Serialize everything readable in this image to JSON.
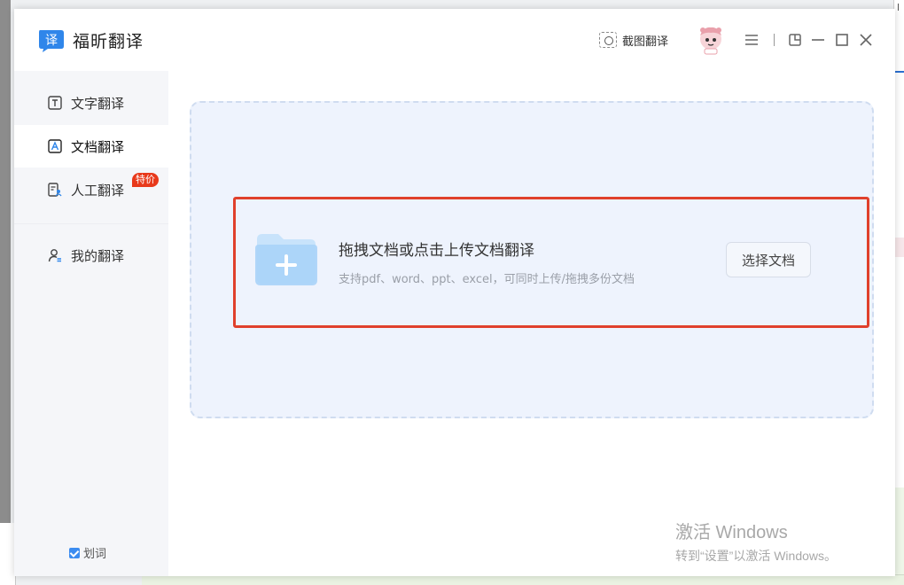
{
  "app": {
    "title": "福昕翻译",
    "logo_char": "译"
  },
  "titlebar": {
    "screenshot_translate_label": "截图翻译",
    "icons": [
      "camera-icon",
      "avatar",
      "menu-icon",
      "pin-icon",
      "minimize-icon",
      "maximize-icon",
      "close-icon"
    ]
  },
  "sidebar": {
    "items": [
      {
        "label": "文字翻译",
        "icon": "text-icon",
        "active": false
      },
      {
        "label": "文档翻译",
        "icon": "document-icon",
        "active": true
      },
      {
        "label": "人工翻译",
        "icon": "human-translate-icon",
        "active": false,
        "badge": "特价"
      },
      {
        "label": "我的翻译",
        "icon": "user-icon",
        "active": false
      }
    ],
    "word_select": {
      "label": "划词",
      "checked": true
    }
  },
  "main": {
    "drop_title": "拖拽文档或点击上传文档翻译",
    "drop_subtitle": "支持pdf、word、ppt、excel，可同时上传/拖拽多份文档",
    "choose_button": "选择文档"
  },
  "watermark": {
    "title": "激活 Windows",
    "subtitle": "转到“设置”以激活 Windows。"
  },
  "colors": {
    "accent": "#3c8cf0",
    "highlight_border": "#e0402c",
    "badge": "#e8391b",
    "dropzone_bg": "#eef3fd"
  }
}
